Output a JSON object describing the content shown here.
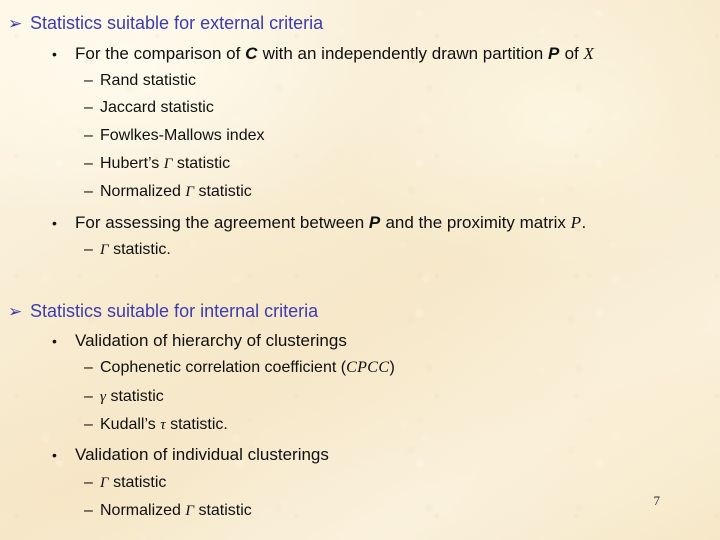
{
  "slide": {
    "background_color": "#faf0d8",
    "heading_color": "#3c3cae",
    "body_color": "#101010",
    "page_number": "7",
    "markers": {
      "arrow": "➢",
      "bullet": "•",
      "dash": "–"
    },
    "sections": [
      {
        "heading": "Statistics suitable for external criteria",
        "bullets": [
          {
            "lead": "For the comparison of ",
            "sym1": "C",
            "mid": " with an independently drawn partition ",
            "sym2": "P",
            "tail": " of ",
            "sym3": "X",
            "end": "",
            "subs": [
              {
                "pre": "Rand statistic",
                "sym": "",
                "post": ""
              },
              {
                "pre": "Jaccard statistic",
                "sym": "",
                "post": ""
              },
              {
                "pre": "Fowlkes-Mallows index",
                "sym": "",
                "post": ""
              },
              {
                "pre": "Hubert’s ",
                "sym": "Γ",
                "post": " statistic"
              },
              {
                "pre": "Normalized ",
                "sym": "Γ",
                "post": " statistic"
              }
            ]
          },
          {
            "lead": "For assessing the agreement between ",
            "sym1": "P",
            "mid": " and the proximity matrix ",
            "sym2": "P",
            "tail": ".",
            "sym3": "",
            "end": "",
            "subs": [
              {
                "pre": "",
                "sym": "Γ",
                "post": " statistic."
              }
            ]
          }
        ]
      },
      {
        "heading": "Statistics suitable for internal criteria",
        "bullets": [
          {
            "lead": "Validation of hierarchy of clusterings",
            "sym1": "",
            "mid": "",
            "sym2": "",
            "tail": "",
            "sym3": "",
            "end": "",
            "subs": [
              {
                "pre": "Cophenetic correlation coefficient (",
                "sym": "CPCC",
                "post": ")"
              },
              {
                "pre": "",
                "sym": "γ",
                "post": " statistic"
              },
              {
                "pre": "Kudall’s ",
                "sym": "τ",
                "post": " statistic."
              }
            ]
          },
          {
            "lead": "Validation of individual clusterings",
            "sym1": "",
            "mid": "",
            "sym2": "",
            "tail": "",
            "sym3": "",
            "end": "",
            "subs": [
              {
                "pre": "",
                "sym": "Γ",
                "post": " statistic"
              },
              {
                "pre": "Normalized ",
                "sym": "Γ",
                "post": " statistic"
              }
            ]
          }
        ]
      }
    ]
  }
}
